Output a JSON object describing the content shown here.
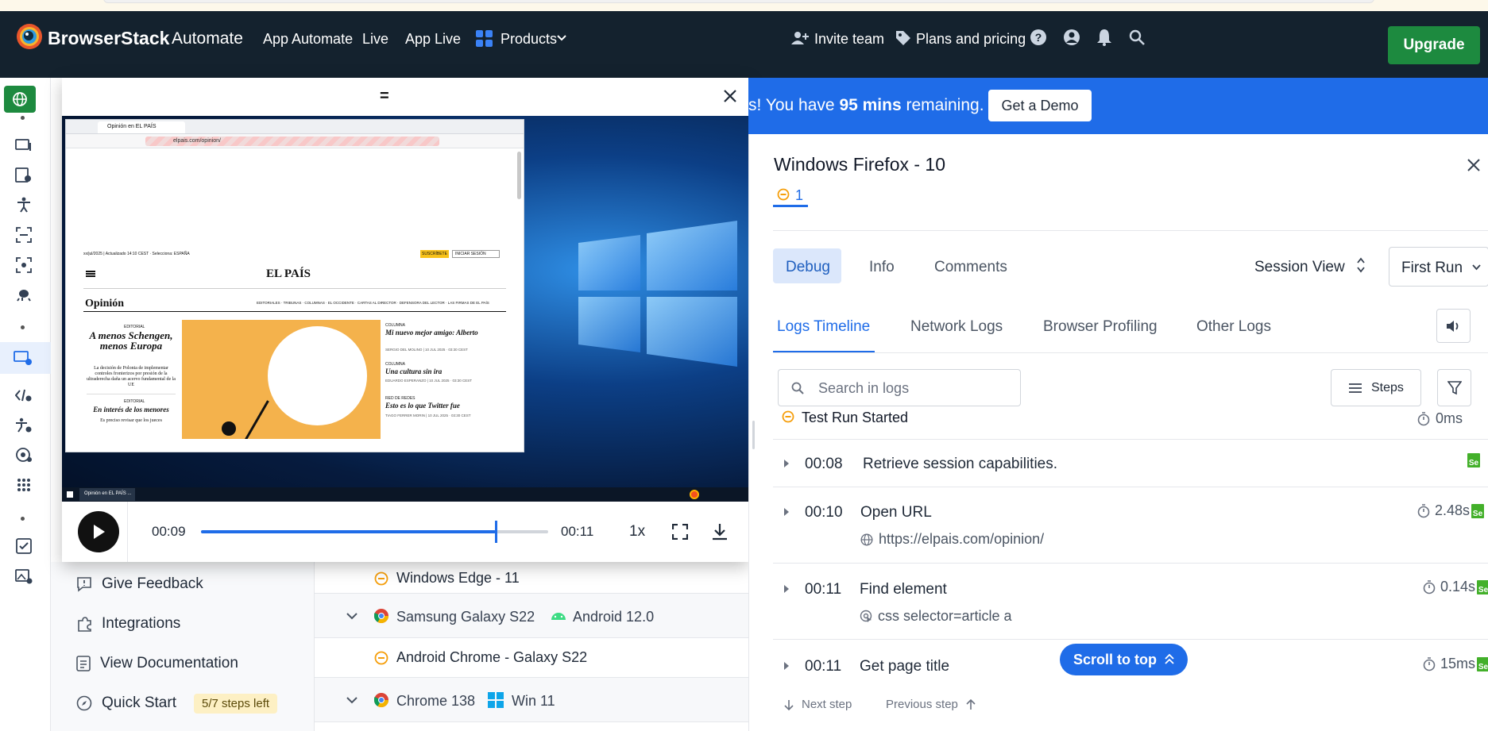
{
  "header": {
    "brand": "BrowserStack",
    "product": "Automate",
    "nav": [
      "App Automate",
      "Live",
      "App Live"
    ],
    "products_label": "Products",
    "invite_label": "Invite team",
    "pricing_label": "Plans and pricing",
    "upgrade_label": "Upgrade",
    "colors": {
      "bg": "#14222e",
      "upgrade": "#1d8a3f"
    }
  },
  "banner": {
    "prefix": "s! You have ",
    "minutes": "95 mins",
    "suffix": " remaining.",
    "demo_label": "Get a Demo",
    "color": "#1f6ce8"
  },
  "video": {
    "drag_handle": "=",
    "current_time": "00:09",
    "total_time": "00:11",
    "speed": "1x",
    "progress_fraction": 0.85,
    "taskbar_item": "Opinión en EL PAÍS ...",
    "browser": {
      "tab_title": "Opinión en EL PAÍS",
      "url": "elpais.com/opinion/",
      "masthead": "EL PAÍS",
      "section": "Opinión",
      "nav_links": "EDITORIALES · TRIBUNAS · COLUMNAS · EL OCCIDENTE · CARTAS AL DIRECTOR · DEFENSORA DEL LECTOR · LAS FIRMAS DE EL PAÍS",
      "subscribe": "SUSCRÍBETE",
      "login": "INICIAR SESIÓN",
      "topline": "xx/jul/2025 | Actualizado 14:10 CEST · Selecciona: ESPAÑA",
      "editorial_kicker": "EDITORIAL",
      "headline": "A menos Schengen, menos Europa",
      "standfirst": "La decisión de Polonia de implementar controles fronterizos por presión de la ultraderecha daña un acervo fundamental de la UE",
      "editorial2_kicker": "EDITORIAL",
      "headline2": "En interés de los menores",
      "body2": "Es preciso revisar que los jueces",
      "col1_kicker": "COLUMNA",
      "col1_title": "Mi nuevo mejor amigo: Alberto",
      "col1_meta": "SERGIO DEL MOLINO | 10 JUL 2025 · 03:30 CEST",
      "col2_kicker": "COLUMNA",
      "col2_title": "Una cultura sin ira",
      "col2_meta": "EDUARDO ESPERANZO | 10 JUL 2025 · 03:30 CEST",
      "col3_kicker": "RED DE REDES",
      "col3_title": "Esto es lo que Twitter fue",
      "col3_meta": "TIAGO FERRER MORIN | 10 JUL 2025 · 03:30 CEST"
    }
  },
  "sidebar_menu": {
    "feedback": "Give Feedback",
    "integrations": "Integrations",
    "docs": "View Documentation",
    "quickstart": "Quick Start",
    "steps_badge": "5/7 steps left"
  },
  "session_table": {
    "rows": [
      {
        "label": "Windows Edge - 11"
      },
      {
        "label": "Samsung Galaxy S22",
        "os": "Android 12.0"
      },
      {
        "label": "Android Chrome - Galaxy S22"
      },
      {
        "label": "Chrome 138",
        "os": "Win 11"
      }
    ]
  },
  "panel": {
    "title": "Windows Firefox - 10",
    "run_tab": "1",
    "subtabs": [
      "Debug",
      "Info",
      "Comments"
    ],
    "session_view": "Session View",
    "run_select": "First Run",
    "log_tabs": [
      "Logs Timeline",
      "Network Logs",
      "Browser Profiling",
      "Other Logs"
    ],
    "search_placeholder": "Search in logs",
    "steps_label": "Steps",
    "test_run_started": "Test Run Started",
    "test_run_duration": "0ms",
    "logs": [
      {
        "time": "00:08",
        "name": "Retrieve session capabilities."
      },
      {
        "time": "00:10",
        "name": "Open URL",
        "detail": "https://elpais.com/opinion/",
        "duration": "2.48s"
      },
      {
        "time": "00:11",
        "name": "Find element",
        "detail": "css selector=article a",
        "duration": "0.14s"
      },
      {
        "time": "00:11",
        "name": "Get page title",
        "duration": "15ms"
      }
    ],
    "scroll_top": "Scroll to top",
    "next_step": "Next step",
    "prev_step": "Previous step"
  }
}
